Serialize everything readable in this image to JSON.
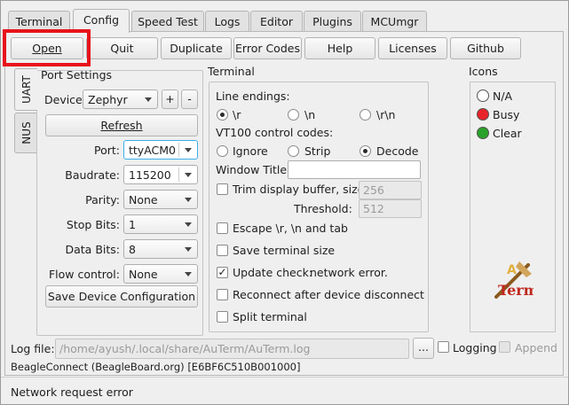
{
  "tabs": [
    "Terminal",
    "Config",
    "Speed Test",
    "Logs",
    "Editor",
    "Plugins",
    "MCUmgr"
  ],
  "toolbar": {
    "open": "Open",
    "quit": "Quit",
    "duplicate": "Duplicate",
    "error_codes": "Error Codes",
    "help": "Help",
    "licenses": "Licenses",
    "github": "Github"
  },
  "side_tabs": [
    "UART",
    "NUS"
  ],
  "port_settings": {
    "title": "Port Settings",
    "device_label": "Device",
    "device_value": "Zephyr",
    "add": "+",
    "remove": "-",
    "refresh": "Refresh",
    "port_label": "Port:",
    "port_value": "ttyACM0",
    "baudrate_label": "Baudrate:",
    "baudrate_value": "115200",
    "parity_label": "Parity:",
    "parity_value": "None",
    "stop_bits_label": "Stop Bits:",
    "stop_bits_value": "1",
    "data_bits_label": "Data Bits:",
    "data_bits_value": "8",
    "flow_control_label": "Flow control:",
    "flow_control_value": "None",
    "save": "Save Device Configuration"
  },
  "terminal": {
    "title": "Terminal",
    "line_endings_label": "Line endings:",
    "line_endings": [
      "\\r",
      "\\n",
      "\\r\\n"
    ],
    "vt100_label": "VT100 control codes:",
    "vt100": [
      "Ignore",
      "Strip",
      "Decode"
    ],
    "window_title_label": "Window Title:",
    "window_title_value": "",
    "trim_label": "Trim display buffer, size:",
    "trim_value": "256",
    "threshold_label": "Threshold:",
    "threshold_value": "512",
    "escape_label": "Escape \\r, \\n and tab",
    "save_size_label": "Save terminal size",
    "update_check_label": "Update check:",
    "update_check_status": "network error.",
    "reconnect_label": "Reconnect after device disconnect",
    "split_label": "Split terminal"
  },
  "icons": {
    "title": "Icons",
    "na": "N/A",
    "busy": "Busy",
    "clear": "Clear",
    "colors": {
      "busy": "#e8232a",
      "clear": "#2aa12a"
    }
  },
  "log": {
    "label": "Log file:",
    "placeholder": "/home/ayush/.local/share/AuTerm/AuTerm.log",
    "browse": "...",
    "logging": "Logging",
    "append": "Append"
  },
  "device_info": "BeagleConnect (BeagleBoard.org) [E6BF6C510B001000]",
  "status_bar": "Network request error"
}
